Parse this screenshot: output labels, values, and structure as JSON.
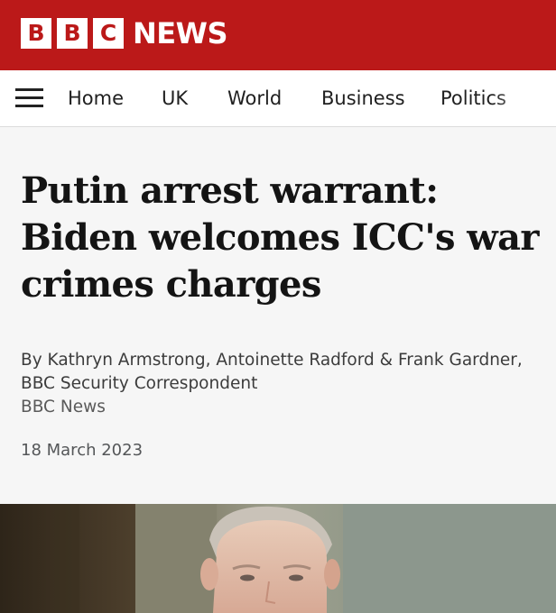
{
  "masthead": {
    "logo_letters": [
      "B",
      "B",
      "C"
    ],
    "logo_word": "NEWS",
    "brand_color": "#bb1919"
  },
  "nav": {
    "menu_icon": "hamburger-menu-icon",
    "items": [
      {
        "label": "Home"
      },
      {
        "label": "UK"
      },
      {
        "label": "World"
      },
      {
        "label": "Business"
      },
      {
        "label": "Politics"
      }
    ]
  },
  "article": {
    "headline": "Putin arrest warrant: Biden welcomes ICC's war crimes charges",
    "byline": "By Kathryn Armstrong, Antoinette Radford & Frank Gardner, BBC Security Correspondent",
    "source": "BBC News",
    "date": "18 March 2023"
  },
  "hero_image": {
    "subject": "photo-of-vladimir-putin"
  }
}
